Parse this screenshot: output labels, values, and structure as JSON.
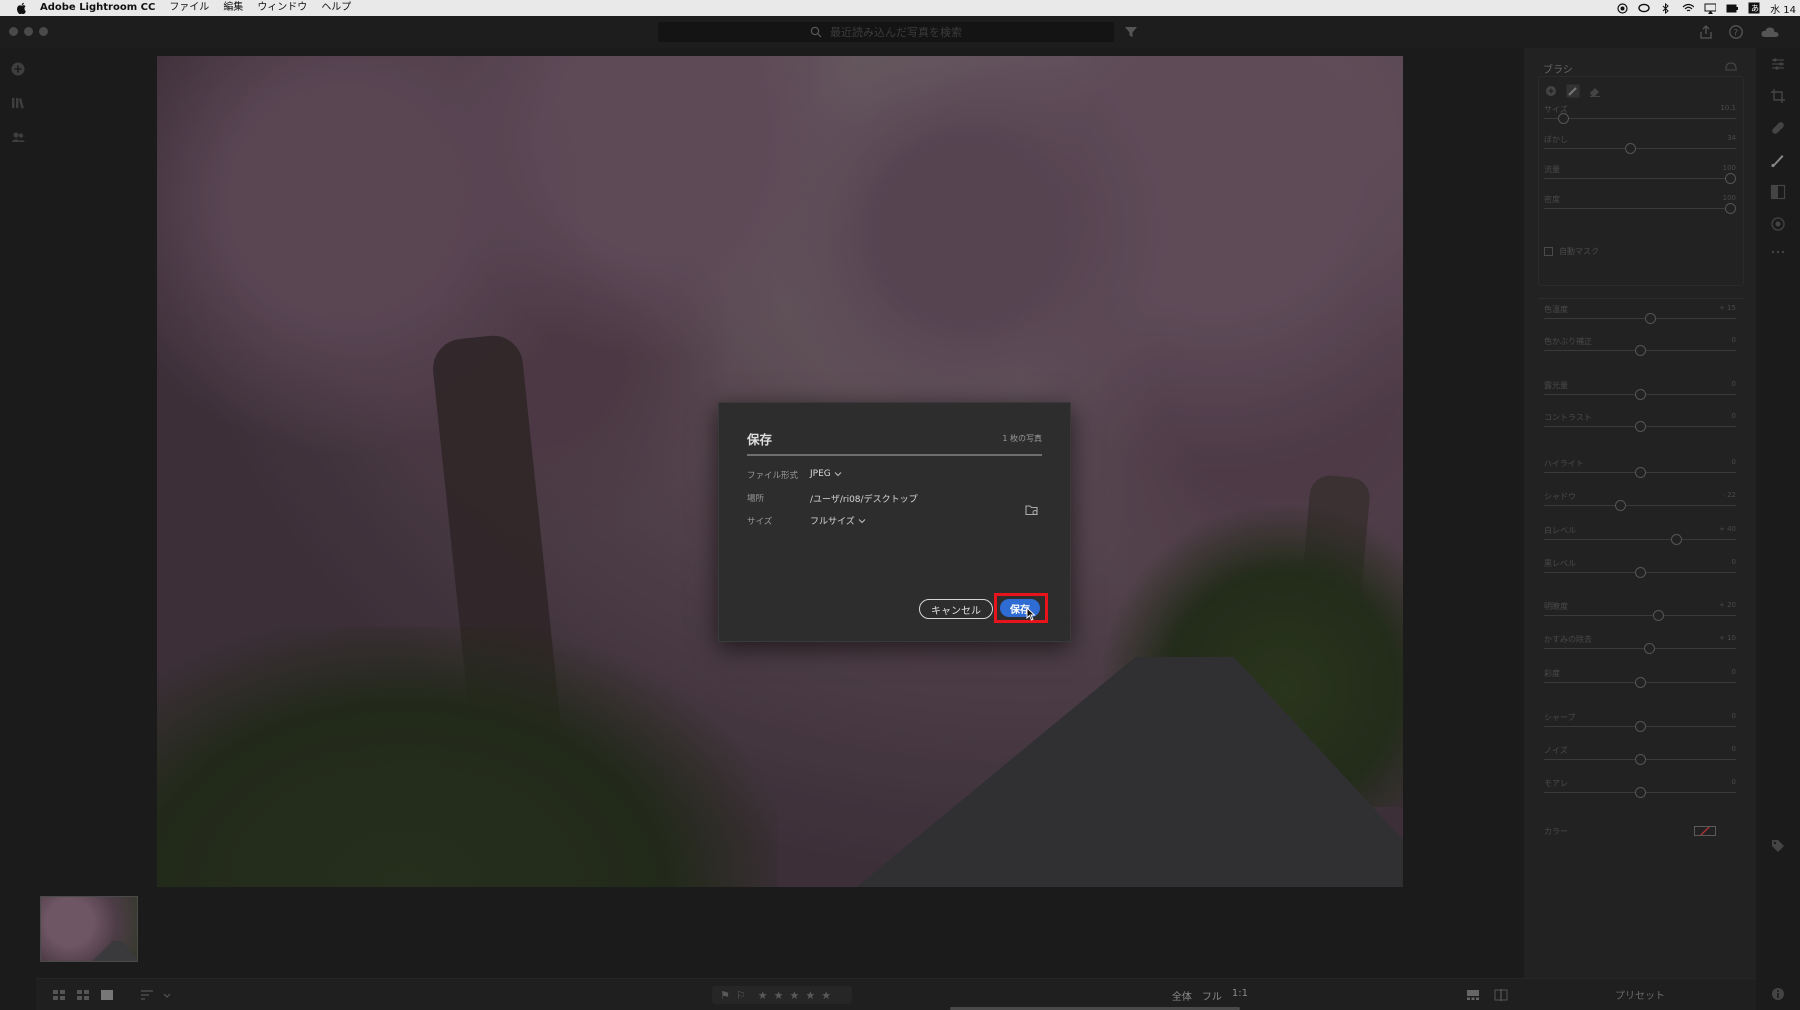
{
  "menubar": {
    "app_name": "Adobe Lightroom CC",
    "items": [
      "ファイル",
      "編集",
      "ウィンドウ",
      "ヘルプ"
    ],
    "clock": "水 14"
  },
  "toolbar": {
    "search_placeholder": "最近読み込んだ写真を検索"
  },
  "dialog": {
    "title": "保存",
    "photo_count": "1 枚の写真",
    "file_format_label": "ファイル形式",
    "file_format_value": "JPEG",
    "location_label": "場所",
    "location_value": "/ユーザ/ri08/デスクトップ",
    "size_label": "サイズ",
    "size_value": "フルサイズ",
    "cancel_label": "キャンセル",
    "save_label": "保存"
  },
  "right_panel": {
    "title": "ブラシ",
    "brush_sliders": [
      {
        "label": "サイズ",
        "value": "10.1",
        "level": 0.08
      },
      {
        "label": "ぼかし",
        "value": "34",
        "level": 0.45
      },
      {
        "label": "流量",
        "value": "100",
        "level": 1.0
      },
      {
        "label": "密度",
        "value": "100",
        "level": 1.0
      }
    ],
    "automask_label": "自動マスク",
    "adjust_sliders": [
      {
        "label": "色温度",
        "value": "+ 15",
        "level": 0.56
      },
      {
        "label": "色かぶり補正",
        "value": "0",
        "level": 0.5
      },
      {
        "label": "露光量",
        "value": "0",
        "level": 0.5
      },
      {
        "label": "コントラスト",
        "value": "0",
        "level": 0.5
      },
      {
        "label": "ハイライト",
        "value": "0",
        "level": 0.5
      },
      {
        "label": "シャドウ",
        "value": "- 22",
        "level": 0.39
      },
      {
        "label": "白レベル",
        "value": "+ 40",
        "level": 0.7
      },
      {
        "label": "黒レベル",
        "value": "0",
        "level": 0.5
      },
      {
        "label": "明瞭度",
        "value": "+ 20",
        "level": 0.6
      },
      {
        "label": "かすみの除去",
        "value": "+ 10",
        "level": 0.55
      },
      {
        "label": "彩度",
        "value": "0",
        "level": 0.5
      },
      {
        "label": "シャープ",
        "value": "0",
        "level": 0.5
      },
      {
        "label": "ノイズ",
        "value": "0",
        "level": 0.5
      },
      {
        "label": "モアレ",
        "value": "0",
        "level": 0.5
      }
    ],
    "color_label": "カラー",
    "presets_label": "プリセット"
  },
  "bottombar": {
    "view_labels": [
      "全体",
      "フル",
      "1:1"
    ]
  },
  "colors": {
    "accent_blue": "#2e6bd3",
    "highlight_red": "#e8131b"
  }
}
